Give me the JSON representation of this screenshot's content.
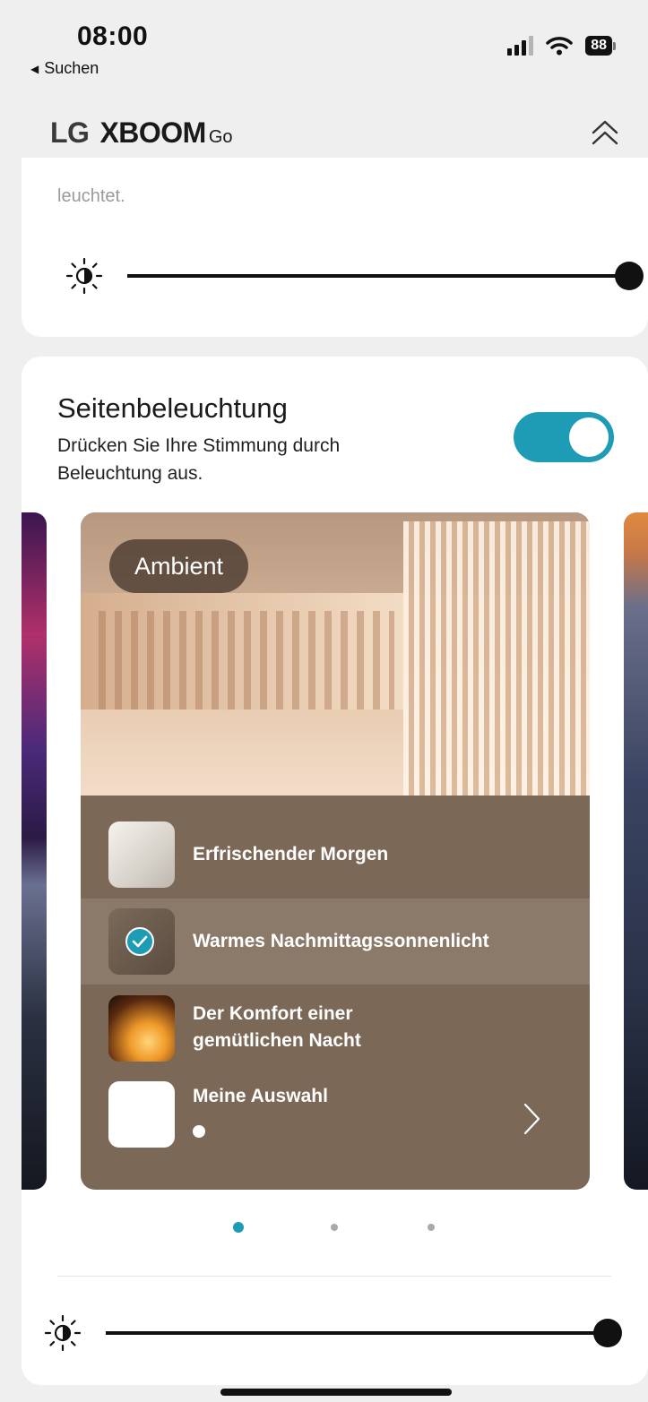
{
  "status_bar": {
    "time": "08:00",
    "back_label": "Suchen",
    "battery": "88",
    "back_icon": "back-triangle-icon",
    "signal_icon": "cellular-signal-icon",
    "wifi_icon": "wifi-icon"
  },
  "header": {
    "brand_lg": "LG",
    "brand_product": "XBOOM",
    "brand_suffix": "Go",
    "collapse_icon": "double-chevron-up-icon"
  },
  "top_card": {
    "cut_text": "leuchtet.",
    "brightness": {
      "icon": "brightness-icon",
      "value_fraction": 1.0
    }
  },
  "side_lighting": {
    "title": "Seitenbeleuchtung",
    "description": "Drücken Sie Ihre Stimmung durch Beleuchtung aus.",
    "enabled": true,
    "accent_color": "#1e9bb5",
    "carousel": {
      "active_index": 0,
      "page_count": 3,
      "mode_name": "Ambient",
      "options": [
        {
          "label": "Erfrischender Morgen",
          "selected": false
        },
        {
          "label": "Warmes Nachmittagssonnenlicht",
          "selected": true
        },
        {
          "label": "Der Komfort einer gemütlichen Nacht",
          "selected": false
        },
        {
          "label": "Meine Auswahl",
          "selected": false
        }
      ]
    },
    "brightness": {
      "icon": "brightness-icon",
      "value_fraction": 1.0
    }
  }
}
